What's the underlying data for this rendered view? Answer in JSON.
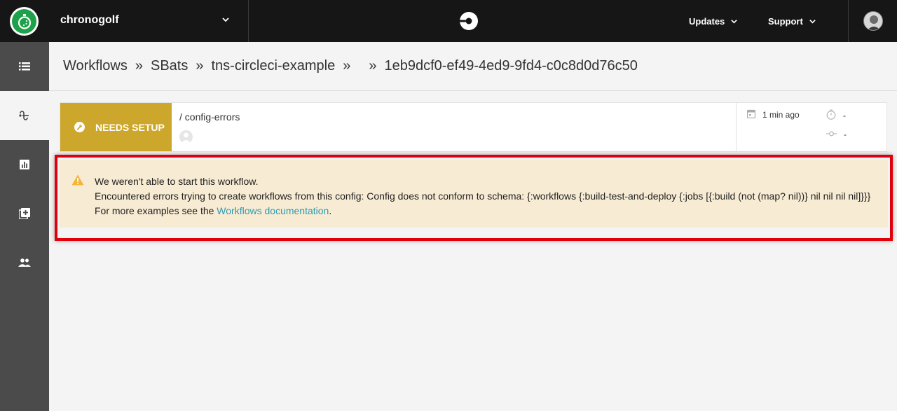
{
  "topnav": {
    "org_name": "chronogolf",
    "updates_label": "Updates",
    "support_label": "Support"
  },
  "sidebar": {
    "items": [
      {
        "name": "builds",
        "icon": "list-icon"
      },
      {
        "name": "workflows",
        "icon": "workflows-icon",
        "active": true
      },
      {
        "name": "insights",
        "icon": "bar-chart-icon"
      },
      {
        "name": "add-projects",
        "icon": "add-project-icon"
      },
      {
        "name": "team",
        "icon": "team-icon"
      }
    ]
  },
  "breadcrumb": {
    "workflows": "Workflows",
    "org": "SBats",
    "project": "tns-circleci-example",
    "sep": "»",
    "workflow_id": "1eb9dcf0-ef49-4ed9-9fd4-c0c8d0d76c50"
  },
  "workflow": {
    "status": "NEEDS SETUP",
    "name": "/ config-errors",
    "time_ago": "1 min ago",
    "duration": "-",
    "commit": "-"
  },
  "error": {
    "title": "We weren't able to start this workflow.",
    "message": "Encountered errors trying to create workflows from this config: Config does not conform to schema: {:workflows {:build-test-and-deploy {:jobs [{:build (not (map? nil))} nil nil nil nil]}}}",
    "more_prefix": "For more examples see the ",
    "link_text": "Workflows documentation",
    "more_suffix": "."
  },
  "colors": {
    "status_needs_setup": "#cda72b",
    "error_bg": "#f7ebd3",
    "highlight_outline": "#e0000b",
    "link": "#2e9bb0"
  }
}
